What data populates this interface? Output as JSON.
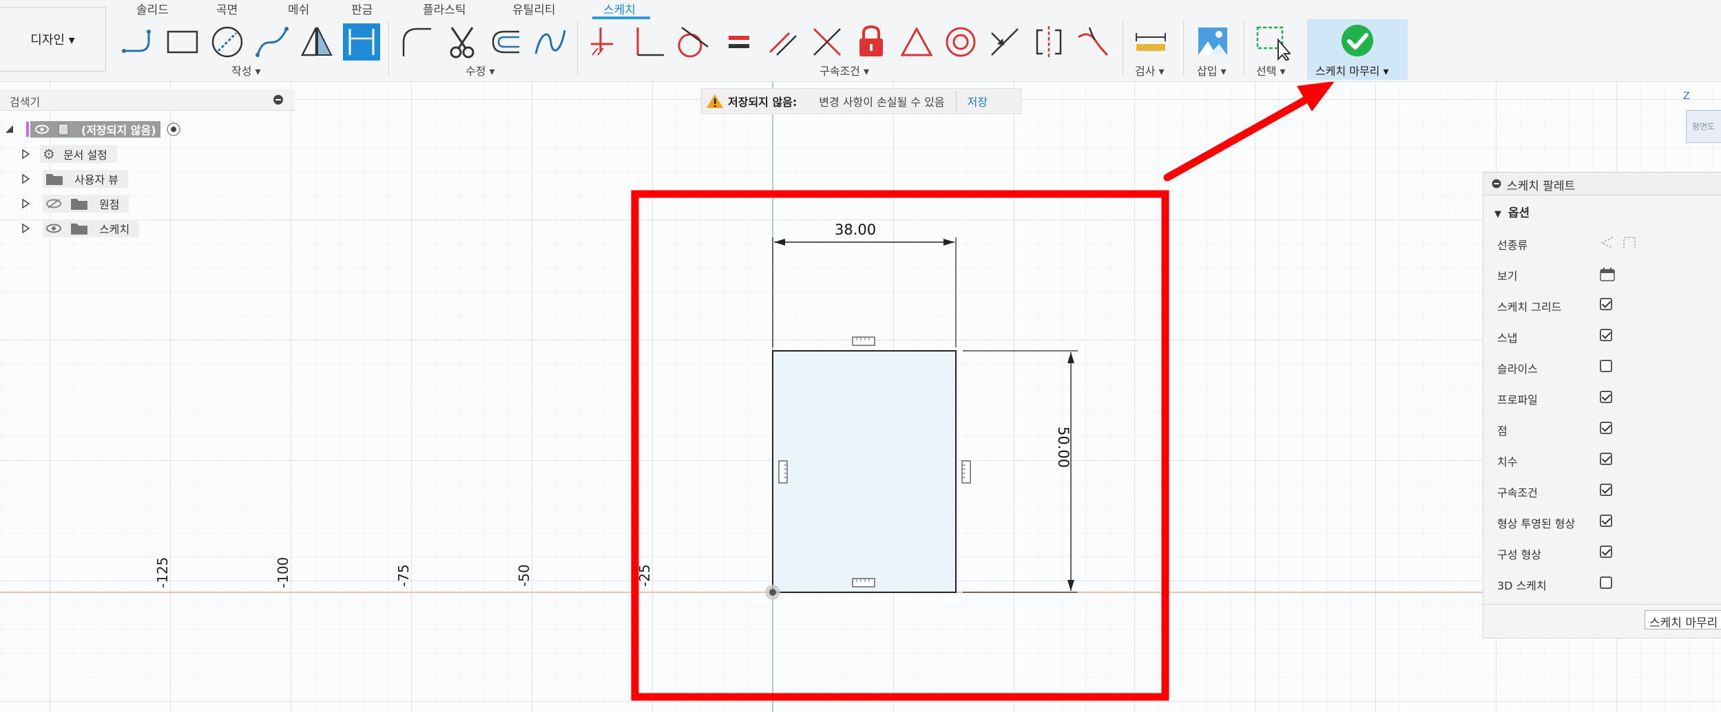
{
  "workspace": {
    "label": "디자인 ▾"
  },
  "tabs": [
    "솔리드",
    "곡면",
    "메쉬",
    "판금",
    "플라스틱",
    "유틸리티",
    "스케치"
  ],
  "groups": {
    "create": "작성 ▾",
    "modify": "수정 ▾",
    "constraints": "구속조건 ▾",
    "inspect": "검사 ▾",
    "insert": "삽입 ▾",
    "select": "선택 ▾",
    "finish": "스케치 마무리 ▾"
  },
  "browser": {
    "title": "검색기",
    "root": "(저장되지 않음)",
    "items": [
      "문서 설정",
      "사용자 뷰",
      "원점",
      "스케치"
    ]
  },
  "message": {
    "title": "저장되지 않음:",
    "text": "변경 사항이 손실될 수 있음",
    "action": "저장"
  },
  "viewcube": {
    "axis": "Z",
    "face": "평면도"
  },
  "ruler": [
    "-125",
    "-100",
    "-75",
    "-50",
    "-25"
  ],
  "dimensions": {
    "width": "38.00",
    "height": "50.00"
  },
  "palette": {
    "title": "스케치 팔레트",
    "section": "옵션",
    "rows": [
      {
        "label": "선종류",
        "type": "icons"
      },
      {
        "label": "보기",
        "type": "icon"
      },
      {
        "label": "스케치 그리드",
        "checked": true
      },
      {
        "label": "스냅",
        "checked": true
      },
      {
        "label": "슬라이스",
        "checked": false
      },
      {
        "label": "프로파일",
        "checked": true
      },
      {
        "label": "점",
        "checked": true
      },
      {
        "label": "치수",
        "checked": true
      },
      {
        "label": "구속조건",
        "checked": true
      },
      {
        "label": "형상 투영된 형상",
        "checked": true
      },
      {
        "label": "구성 형상",
        "checked": true
      },
      {
        "label": "3D 스케치",
        "checked": false
      }
    ],
    "finish_button": "스케치 마무리"
  },
  "colors": {
    "accent": "#2d9bd8",
    "annotation": "#ff0000",
    "finish": "#21b24b"
  }
}
